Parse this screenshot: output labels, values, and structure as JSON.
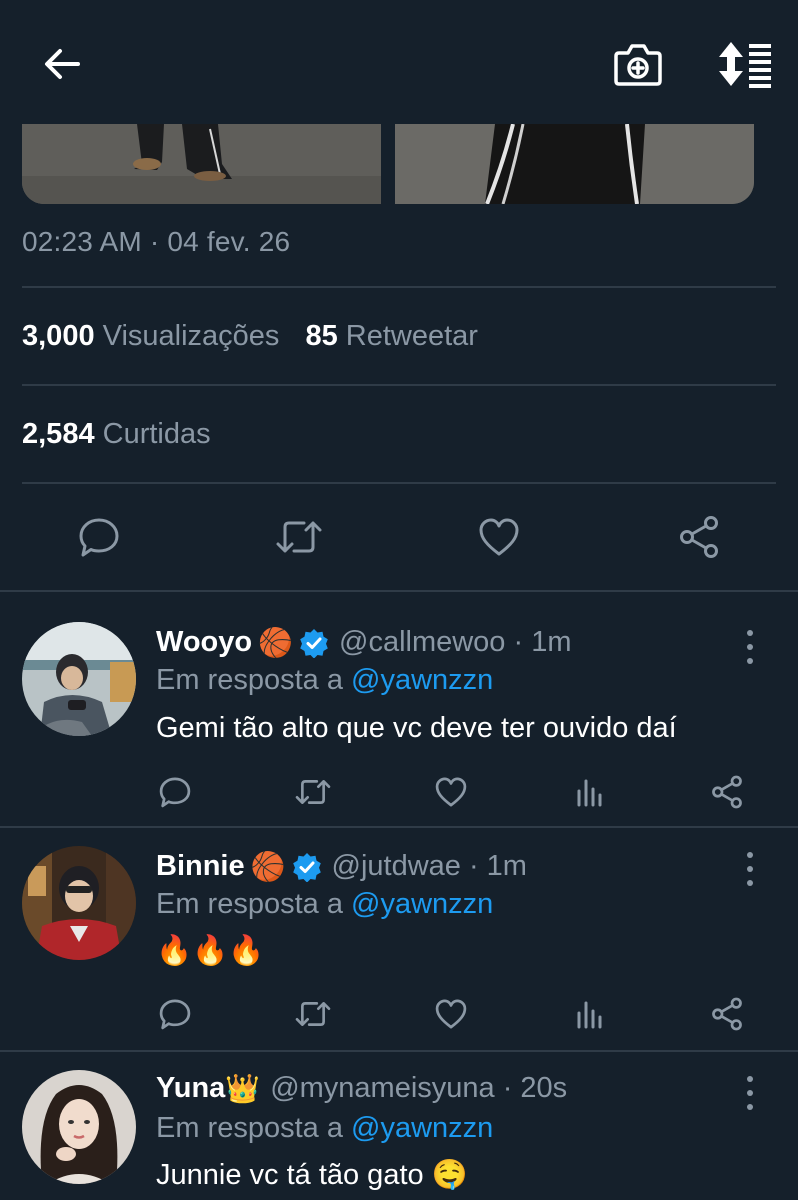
{
  "header": {
    "back_icon": "arrow-left-icon",
    "camera_icon": "camera-plus-icon",
    "sort_icon": "sort-list-icon"
  },
  "tweet": {
    "timestamp": "02:23 AM · 04 fev. 26",
    "views_count": "3,000",
    "views_label": "Visualizações",
    "retweets_count": "85",
    "retweets_label": "Retweetar",
    "likes_count": "2,584",
    "likes_label": "Curtidas"
  },
  "replies": [
    {
      "name": "Wooyo",
      "name_emoji": "🏀",
      "verified": true,
      "handle_time": "@callmewoo · 1m",
      "replying_prefix": "Em resposta a",
      "replying_to": "@yawnzzn",
      "text": "Gemi tão alto que vc deve ter ouvido daí"
    },
    {
      "name": "Binnie",
      "name_emoji": "🏀",
      "verified": true,
      "handle_time": "@jutdwae · 1m",
      "replying_prefix": "Em resposta a",
      "replying_to": "@yawnzzn",
      "text": "🔥🔥🔥"
    },
    {
      "name": "Yuna",
      "name_emoji": "👑",
      "verified": false,
      "handle_time": "@mynameisyuna · 20s",
      "replying_prefix": "Em resposta a",
      "replying_to": "@yawnzzn",
      "text": "Junnie vc tá tão gato 🤤"
    }
  ],
  "colors": {
    "background": "#15202b",
    "muted_text": "#8b98a5",
    "accent": "#1d9bf0",
    "divider": "#2f3b47"
  }
}
